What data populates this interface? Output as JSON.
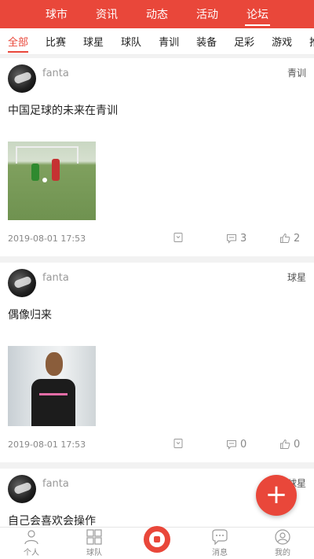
{
  "topnav": {
    "tabs": [
      "球市",
      "资讯",
      "动态",
      "活动",
      "论坛"
    ],
    "active": "论坛"
  },
  "categories": {
    "items": [
      "全部",
      "比赛",
      "球星",
      "球队",
      "青训",
      "装备",
      "足彩",
      "游戏",
      "推"
    ],
    "active": "全部"
  },
  "posts": [
    {
      "user": "fanta",
      "tag": "青训",
      "text": "中国足球的未来在青训",
      "date": "2019-08-01 17:53",
      "comments": "3",
      "likes": "2"
    },
    {
      "user": "fanta",
      "tag": "球星",
      "text": "偶像归来",
      "date": "2019-08-01 17:53",
      "comments": "0",
      "likes": "0"
    },
    {
      "user": "fanta",
      "tag": "球星",
      "text": "自己会喜欢会操作"
    }
  ],
  "fab": {
    "label": "+"
  },
  "bottombar": {
    "items": [
      "个人",
      "球队",
      "",
      "消息",
      "我的"
    ]
  },
  "colors": {
    "accent": "#e9473a"
  }
}
